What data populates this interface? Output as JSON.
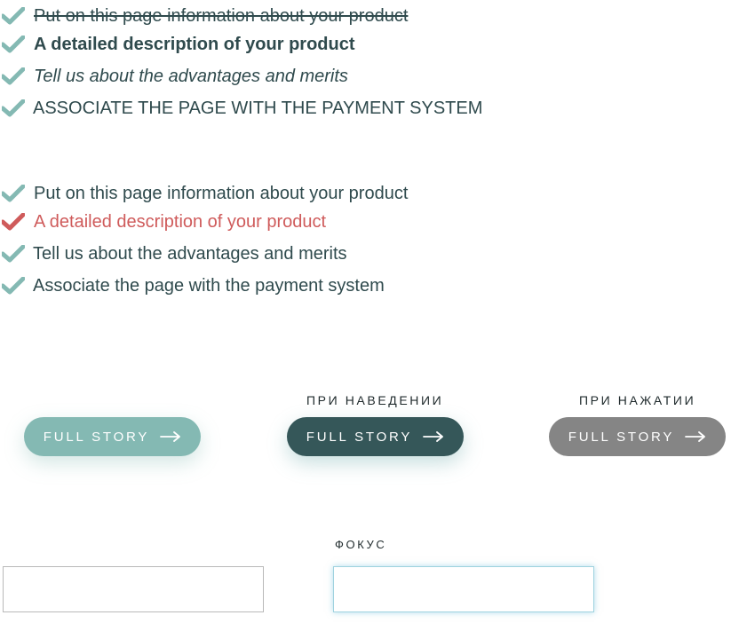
{
  "list_styled": {
    "items": [
      {
        "text": "Put on this page information about your product",
        "style": "strikethrough",
        "icon": "check-icon"
      },
      {
        "text": "A detailed description of your product",
        "style": "bold",
        "icon": "check-icon"
      },
      {
        "text": "Tell us about the advantages and merits",
        "style": "italic",
        "icon": "check-icon"
      },
      {
        "text": "Associate the page with the payment system",
        "style": "uppercase",
        "icon": "check-icon"
      }
    ]
  },
  "list_states": {
    "items": [
      {
        "text": "Put on this page information about your product",
        "state": "normal",
        "icon": "check-icon"
      },
      {
        "text": "A detailed description of your product",
        "state": "error",
        "icon": "check-icon"
      },
      {
        "text": "Tell us about the advantages and merits",
        "state": "normal",
        "icon": "check-icon"
      },
      {
        "text": "Associate the page with the payment system",
        "state": "normal",
        "icon": "check-icon"
      }
    ]
  },
  "buttons": {
    "hover_caption": "ПРИ НАВЕДЕНИИ",
    "pressed_caption": "ПРИ НАЖАТИИ",
    "default": {
      "label": "FULL STORY",
      "icon": "arrow-right-icon",
      "color": "#84b9b3"
    },
    "hover": {
      "label": "FULL STORY",
      "icon": "arrow-right-icon",
      "color": "#355759"
    },
    "pressed": {
      "label": "FULL STORY",
      "icon": "arrow-right-icon",
      "color": "#858585"
    }
  },
  "inputs": {
    "focus_caption": "ФОКУС",
    "default": {
      "value": "",
      "placeholder": ""
    },
    "focused": {
      "value": "",
      "placeholder": ""
    }
  },
  "colors": {
    "check": "#84b9b3",
    "check_error": "#cf5b5b",
    "text": "#2f4a4d",
    "error_text": "#cf5b5b",
    "focus_border": "#9fd2df"
  }
}
